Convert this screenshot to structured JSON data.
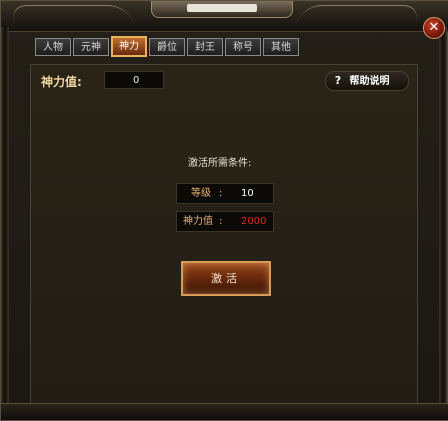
{
  "window": {
    "title": ""
  },
  "tabs": [
    {
      "label": "人物",
      "active": false
    },
    {
      "label": "元神",
      "active": false
    },
    {
      "label": "神力",
      "active": true
    },
    {
      "label": "爵位",
      "active": false
    },
    {
      "label": "封王",
      "active": false
    },
    {
      "label": "称号",
      "active": false
    },
    {
      "label": "其他",
      "active": false
    }
  ],
  "shenli": {
    "label": "神力值:",
    "value": "0"
  },
  "help": {
    "icon": "question-icon",
    "label": "帮助说明"
  },
  "conditions": {
    "title": "激活所需条件:",
    "level": {
      "label": "等级",
      "sep": ":",
      "value": "10",
      "color": "#ffffff"
    },
    "power": {
      "label": "神力值",
      "sep": ":",
      "value": "2000",
      "color": "#e02a1a"
    }
  },
  "activate_button": {
    "label": "激活"
  },
  "colors": {
    "accent_gold": "#e6b460",
    "tab_active": "#c26e2c",
    "close": "#c9402a",
    "warning_red": "#e02a1a"
  }
}
